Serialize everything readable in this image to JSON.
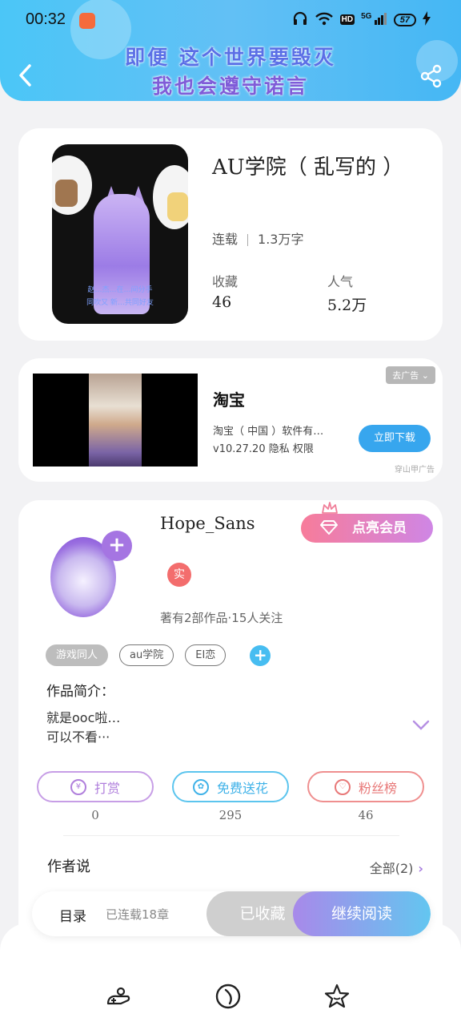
{
  "status_bar": {
    "time": "00:32",
    "battery": "57",
    "network": "5G",
    "hd": "HD"
  },
  "header": {
    "banner_line1": "即便 这个世界要毁灭",
    "banner_line2": "我也会遵守诺言"
  },
  "book": {
    "title": "AU学院（ 乱写的 ）",
    "status": "连载",
    "word_count": "1.3万字",
    "favorites_label": "收藏",
    "favorites_value": "46",
    "popularity_label": "人气",
    "popularity_value": "5.2万",
    "cover_caption_1": "赵…杰…在…间分手",
    "cover_caption_2": "同吹又 新…共同好友"
  },
  "ad": {
    "close_label": "去广告",
    "title": "淘宝",
    "desc_line1": "淘宝（ 中国 ）软件有…",
    "desc_line2": "v10.27.20  隐私  权限",
    "button": "立即下载",
    "source": "穿山甲广告"
  },
  "author": {
    "name": "Hope_Sans",
    "vip_button": "点亮会员",
    "verify_badge": "实",
    "stats": "著有2部作品·15人关注",
    "tags": [
      "游戏同人",
      "au学院",
      "EI恋"
    ],
    "intro_label": "作品简介：",
    "intro_line1": "就是ooc啦…",
    "intro_line2": "可以不看···",
    "actions": [
      {
        "label": "打赏",
        "icon": "¥",
        "count": "0"
      },
      {
        "label": "免费送花",
        "icon": "✿",
        "count": "295"
      },
      {
        "label": "粉丝榜",
        "icon": "♡",
        "count": "46"
      }
    ],
    "author_say": "作者说",
    "all_link": "全部(2)"
  },
  "read_bar": {
    "toc": "目录",
    "toc_sub": "已连载18章",
    "collected": "已收藏",
    "continue": "继续阅读"
  },
  "colors": {
    "header": "#4bc6f7",
    "accent_purple": "#a575e2",
    "accent_blue": "#47bdf1",
    "ad_button": "#37a6ee"
  },
  "icons": {
    "back": "chevron-left-icon",
    "share": "share-icon",
    "tab1": "game-controller-icon",
    "tab2": "compass-icon",
    "tab3": "star-icon"
  }
}
